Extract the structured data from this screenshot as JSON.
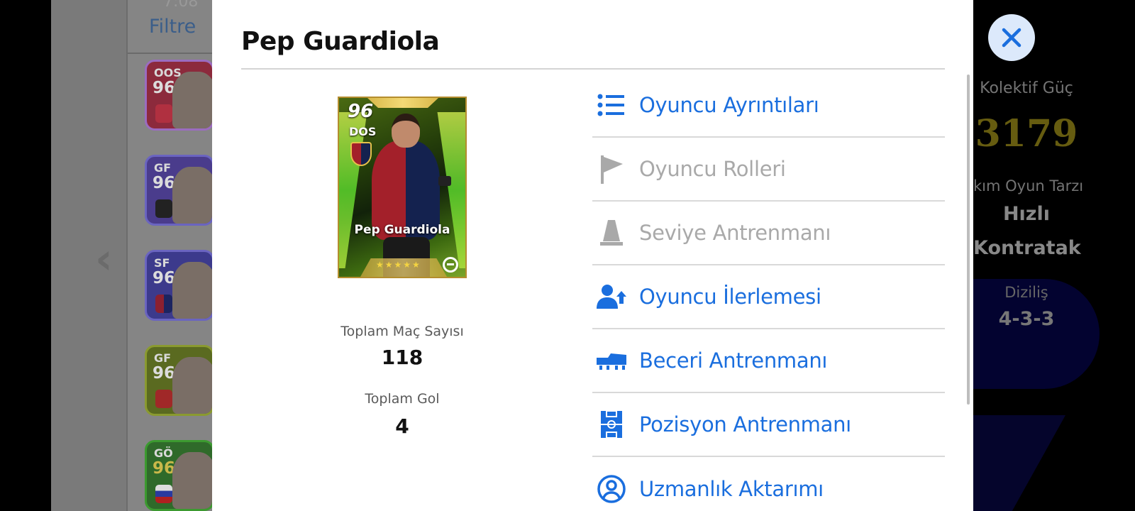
{
  "background": {
    "status_time": "7:08",
    "filter_label": "Filtre",
    "list_cards": [
      {
        "pos": "OOS",
        "rating": "96",
        "color": "#8c2a3c"
      },
      {
        "pos": "GF",
        "rating": "96",
        "color": "#4a3c8c"
      },
      {
        "pos": "SF",
        "rating": "96",
        "color": "#3c3a8c"
      },
      {
        "pos": "GF",
        "rating": "96",
        "color": "#5a6a20"
      },
      {
        "pos": "GÖ",
        "rating": "96",
        "color": "#2f6a2a"
      }
    ],
    "team_power_label": "Kolektif Güç",
    "team_power_value": "3179",
    "play_style_label": "kım Oyun Tarzı",
    "play_style_line1": "Hızlı",
    "play_style_line2": "Kontratak",
    "formation_label": "Diziliş",
    "formation_value": "4-3-3"
  },
  "modal": {
    "title": "Pep Guardiola",
    "card": {
      "rating": "96",
      "position": "DOS",
      "name": "Pep Guardiola",
      "stars": "★★★★★"
    },
    "stats": {
      "matches_label": "Toplam Maç Sayısı",
      "matches_value": "118",
      "goals_label": "Toplam Gol",
      "goals_value": "4"
    },
    "menu": [
      {
        "label": "Oyuncu Ayrıntıları",
        "icon": "list-icon",
        "enabled": true
      },
      {
        "label": "Oyuncu Rolleri",
        "icon": "flag-icon",
        "enabled": false
      },
      {
        "label": "Seviye Antrenmanı",
        "icon": "cone-icon",
        "enabled": false
      },
      {
        "label": "Oyuncu İlerlemesi",
        "icon": "player-progress-icon",
        "enabled": true
      },
      {
        "label": "Beceri Antrenmanı",
        "icon": "boot-icon",
        "enabled": true
      },
      {
        "label": "Pozisyon Antrenmanı",
        "icon": "pitch-icon",
        "enabled": true
      },
      {
        "label": "Uzmanlık Aktarımı",
        "icon": "expertise-transfer-icon",
        "enabled": true
      }
    ]
  },
  "colors": {
    "accent": "#1a6ede",
    "disabled": "#a9a9a9",
    "close_bg": "#dce9fb"
  }
}
